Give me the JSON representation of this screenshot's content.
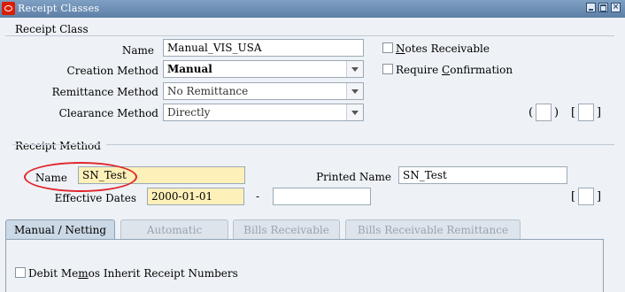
{
  "window": {
    "title": "Receipt Classes"
  },
  "receipt_class": {
    "section_title": "Receipt Class",
    "name_label": "Name",
    "name_value": "Manual_VIS_USA",
    "creation_method_label": "Creation Method",
    "creation_method_value": "Manual",
    "remittance_method_label": "Remittance Method",
    "remittance_method_value": "No Remittance",
    "clearance_method_label": "Clearance Method",
    "clearance_method_value": "Directly",
    "notes_receivable_label_first": "N",
    "notes_receivable_label_rest": "otes Receivable",
    "require_confirmation_label_first": "Require ",
    "require_confirmation_label_underlined": "C",
    "require_confirmation_label_rest": "onfirmation",
    "notes_receivable_checked": false,
    "require_confirmation_checked": false,
    "paren_open": "(",
    "paren_close": ")",
    "bracket_open": "[",
    "bracket_close": "]"
  },
  "receipt_method": {
    "section_title": "Receipt Method",
    "name_label": "Name",
    "name_value": "SN_Test",
    "printed_name_label": "Printed Name",
    "printed_name_value": "SN_Test",
    "effective_dates_label": "Effective Dates",
    "effective_date_from": "2000-01-01",
    "effective_date_separator": "-",
    "effective_date_to": "",
    "bracket_open": "[",
    "bracket_close": "]"
  },
  "tabs": [
    {
      "label": "Manual / Netting",
      "active": true
    },
    {
      "label": "Automatic",
      "active": false
    },
    {
      "label": "Bills Receivable",
      "active": false
    },
    {
      "label": "Bills Receivable Remittance",
      "active": false
    }
  ],
  "manual_netting": {
    "debit_memos_label_first": "Debit Me",
    "debit_memos_label_underlined": "m",
    "debit_memos_label_rest": "os Inherit Receipt Numbers",
    "debit_memos_checked": false
  },
  "colors": {
    "title_bar": "#5d7fa6",
    "required_field": "#fdf0b9",
    "highlight_oval": "#e0262c",
    "background": "#eef2f6"
  }
}
